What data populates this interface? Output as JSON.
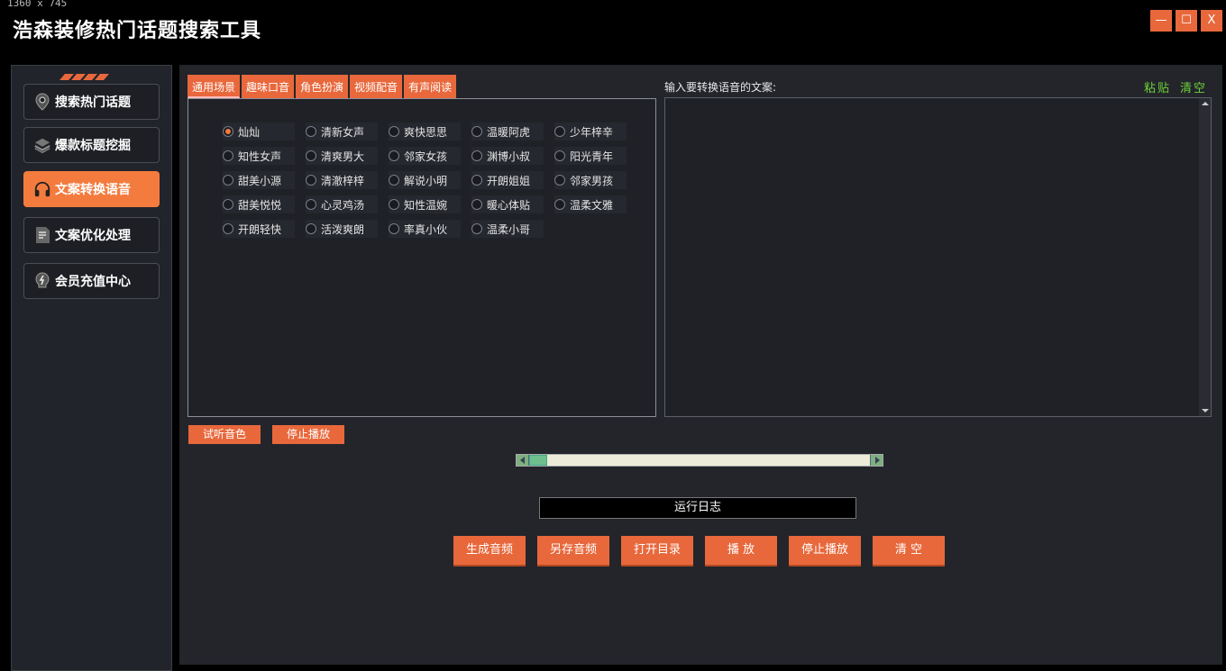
{
  "screen_label": "1360 x 745",
  "app_title": "浩森装修热门话题搜索工具",
  "window_controls": {
    "minimize": "—",
    "maximize": "☐",
    "close": "X"
  },
  "sidebar": {
    "items": [
      {
        "label": "搜索热门话题",
        "icon": "location-pin-icon",
        "active": false
      },
      {
        "label": "爆款标题挖掘",
        "icon": "layers-icon",
        "active": false
      },
      {
        "label": "文案转换语音",
        "icon": "headphones-icon",
        "active": true
      },
      {
        "label": "文案优化处理",
        "icon": "document-icon",
        "active": false
      },
      {
        "label": "会员充值中心",
        "icon": "lightning-bulb-icon",
        "active": false
      }
    ]
  },
  "tabs": [
    "通用场景",
    "趣味口音",
    "角色扮演",
    "视频配音",
    "有声阅读"
  ],
  "active_tab": 0,
  "voices": [
    [
      "灿灿",
      "清新女声",
      "爽快思思",
      "温暖阿虎",
      "少年梓辛"
    ],
    [
      "知性女声",
      "清爽男大",
      "邻家女孩",
      "渊博小叔",
      "阳光青年"
    ],
    [
      "甜美小源",
      "清澈梓梓",
      "解说小明",
      "开朗姐姐",
      "邻家男孩"
    ],
    [
      "甜美悦悦",
      "心灵鸡汤",
      "知性温婉",
      "暖心体贴",
      "温柔文雅"
    ],
    [
      "开朗轻快",
      "活泼爽朗",
      "率真小伙",
      "温柔小哥"
    ]
  ],
  "selected_voice": "灿灿",
  "text_input": {
    "label": "输入要转换语音的文案:",
    "value": ""
  },
  "paste_label": "粘贴",
  "clear_label": "清空",
  "preview_button": "试听音色",
  "stop_preview_button": "停止播放",
  "progress_fraction": 0.0,
  "log_label": "运行日志",
  "actions": [
    "生成音频",
    "另存音频",
    "打开目录",
    "播 放",
    "停止播放",
    "清 空"
  ]
}
